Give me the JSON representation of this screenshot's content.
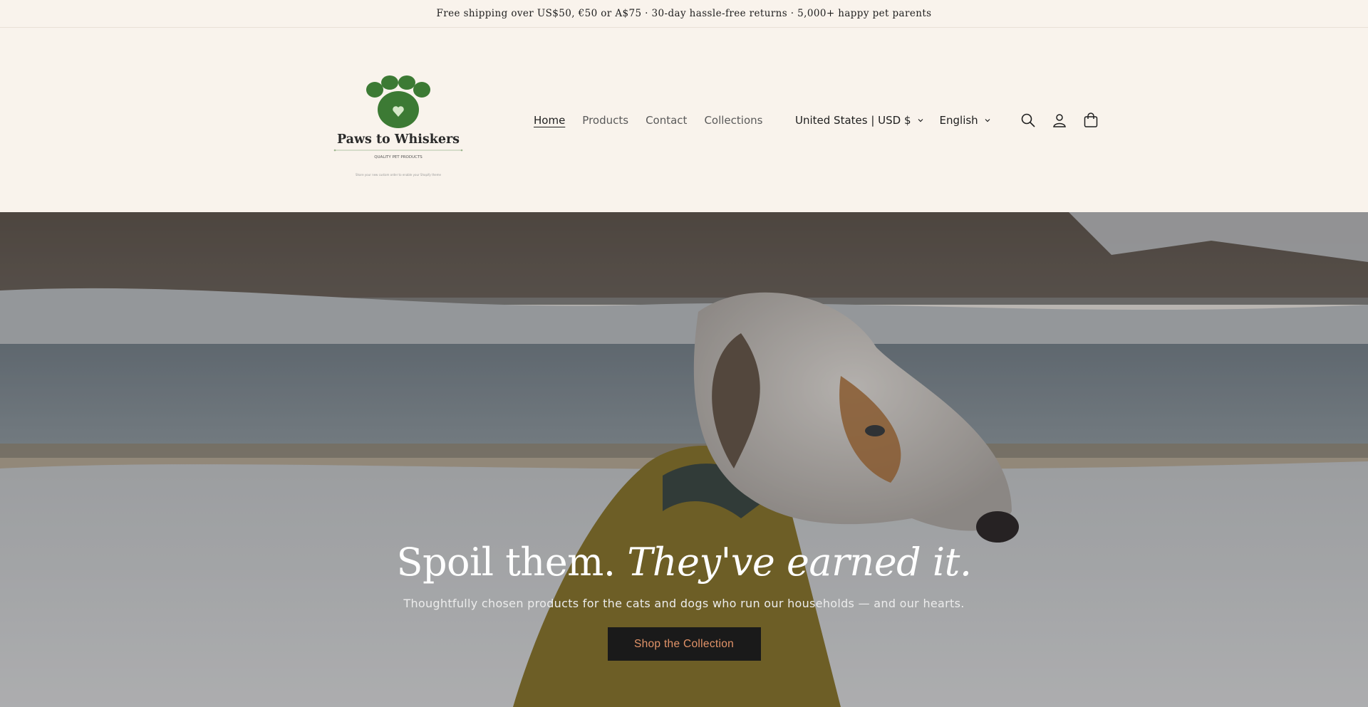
{
  "announcement": "Free shipping over US$50, €50 or A$75 · 30-day hassle-free returns · 5,000+ happy pet parents",
  "logo": {
    "name": "Paws to Whiskers",
    "tagline": "QUALITY PET PRODUCTS",
    "fine_print": "Share your new custom order to enable your Shopify theme",
    "color": "#3c7a34"
  },
  "nav": {
    "items": [
      "Home",
      "Products",
      "Contact",
      "Collections"
    ],
    "active": "Home"
  },
  "localization": {
    "country": "United States | USD $",
    "language": "English"
  },
  "icons": [
    "search-icon",
    "account-icon",
    "cart-icon",
    "chevron-down-icon"
  ],
  "hero": {
    "title_plain": "Spoil them.",
    "title_italic": "They've earned it.",
    "subtitle": "Thoughtfully chosen products for the cats and dogs who run our households — and our hearts.",
    "cta": "Shop the Collection"
  },
  "colors": {
    "background": "#f9f3ec",
    "button_bg": "#1a1a1a",
    "button_text": "#e39469",
    "brand_green": "#3c7a34"
  }
}
